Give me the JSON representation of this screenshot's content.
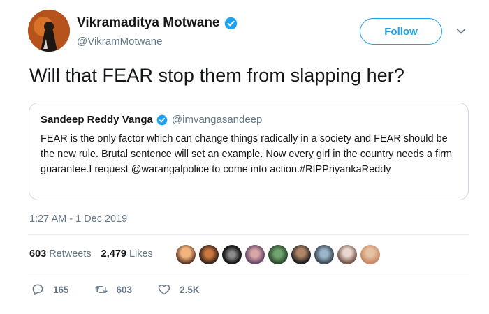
{
  "author": {
    "name": "Vikramaditya Motwane",
    "handle": "@VikramMotwane"
  },
  "follow_label": "Follow",
  "tweet_text": "Will that FEAR stop them from slapping her?",
  "quoted": {
    "name": "Sandeep Reddy Vanga",
    "handle": "@imvangasandeep",
    "text": "FEAR is the only factor which can change things radically in a society and FEAR should be the new rule. Brutal sentence will set an example. Now every girl in the country needs a firm guarantee.I request @warangalpolice to come into action.#RIPPriyankaReddy"
  },
  "timestamp": "1:27 AM - 1 Dec 2019",
  "stats": {
    "retweets_count": "603",
    "retweets_label": "Retweets",
    "likes_count": "2,479",
    "likes_label": "Likes"
  },
  "actions": {
    "reply_count": "165",
    "retweet_count": "603",
    "like_count": "2.5K"
  },
  "colors": {
    "accent": "#1da1f2",
    "secondary_text": "#657786",
    "border": "#ccd6dd"
  },
  "icons": [
    "verified-badge-icon",
    "chevron-down-icon",
    "reply-icon",
    "retweet-icon",
    "heart-icon"
  ]
}
